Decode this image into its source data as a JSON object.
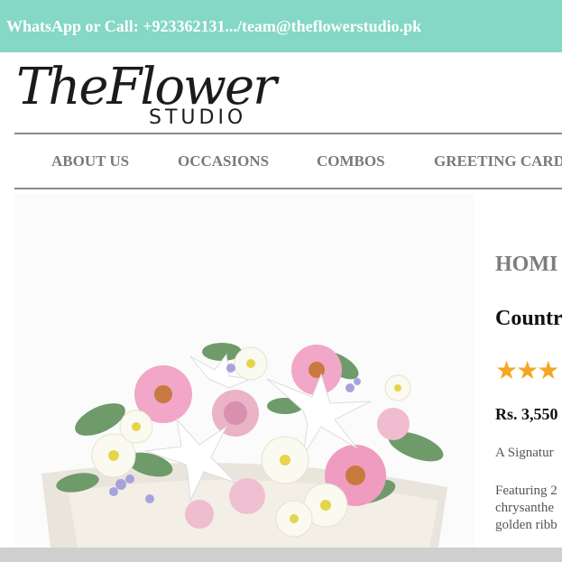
{
  "topbar": {
    "contact_text": "WhatsApp or Call: +923362131.../team@theflowerstudio.pk"
  },
  "logo": {
    "script_text": "TheFlower",
    "subtitle": "STUDIO"
  },
  "nav": {
    "items": [
      {
        "label": "ABOUT US"
      },
      {
        "label": "OCCASIONS"
      },
      {
        "label": "COMBOS"
      },
      {
        "label": "GREETING CARD"
      }
    ]
  },
  "product": {
    "breadcrumb": "HOMI",
    "title": "Countr",
    "rating_stars": "★★★",
    "rating_color": "#f5a623",
    "price": "Rs. 3,550",
    "short_description": "A Signatur",
    "description_lines": [
      "Featuring 2",
      "chrysanthe",
      "golden ribb"
    ]
  },
  "colors": {
    "topbar": "#84d8c5",
    "nav_text": "#7a7a7a",
    "star": "#f5a623"
  }
}
